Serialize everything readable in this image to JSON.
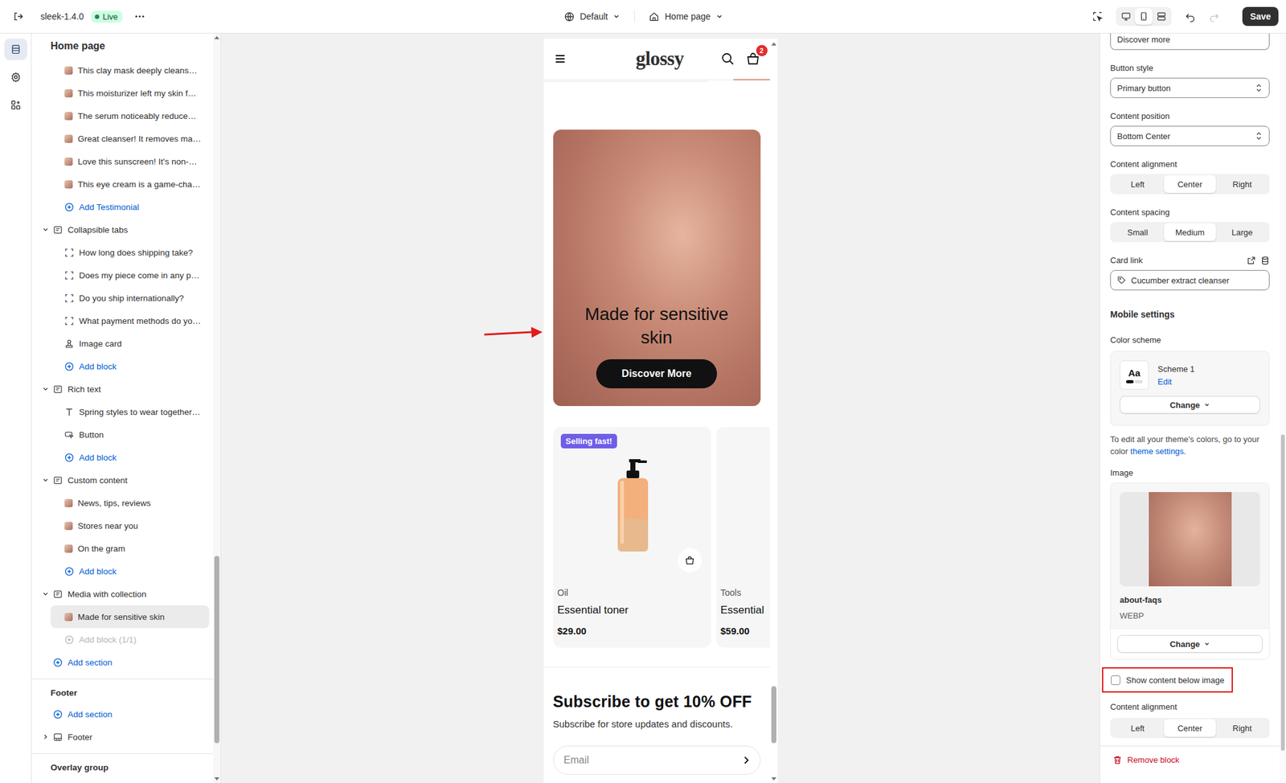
{
  "topbar": {
    "theme": "sleek-1.4.0",
    "status": "Live",
    "context": "Default",
    "page": "Home page",
    "save": "Save",
    "views": [
      {
        "selected": false
      },
      {
        "selected": true
      },
      {
        "selected": false
      }
    ],
    "redo_disabled": true
  },
  "rail": [
    {
      "selected": true
    },
    {
      "selected": false
    },
    {
      "selected": false
    }
  ],
  "sidebar": {
    "title": "Home page",
    "items": [
      {
        "kind": "photo",
        "label": "This clay mask deeply cleans…",
        "selected": false
      },
      {
        "kind": "photo",
        "label": "This moisturizer left my skin f…",
        "selected": false
      },
      {
        "kind": "photo",
        "label": "The serum noticeably reduce…",
        "selected": false
      },
      {
        "kind": "photo",
        "label": "Great cleanser! It removes ma…",
        "selected": false
      },
      {
        "kind": "photo",
        "label": "Love this sunscreen! It's non-…",
        "selected": false
      },
      {
        "kind": "photo",
        "label": "This eye cream is a game-cha…",
        "selected": false
      },
      {
        "kind": "add",
        "label": "Add Testimonial",
        "selected": false,
        "disabled": false
      },
      {
        "kind": "section",
        "label": "Collapsible tabs",
        "selected": false,
        "expanded": true
      },
      {
        "kind": "tab",
        "label": "How long does shipping take?",
        "selected": false
      },
      {
        "kind": "tab",
        "label": "Does my piece come in any p…",
        "selected": false
      },
      {
        "kind": "tab",
        "label": "Do you ship internationally?",
        "selected": false
      },
      {
        "kind": "tab",
        "label": "What payment methods do yo…",
        "selected": false
      },
      {
        "kind": "card",
        "label": "Image card",
        "selected": false
      },
      {
        "kind": "add",
        "label": "Add block",
        "selected": false,
        "disabled": false
      },
      {
        "kind": "section",
        "label": "Rich text",
        "selected": false,
        "expanded": true
      },
      {
        "kind": "text",
        "label": "Spring styles to wear together…",
        "selected": false
      },
      {
        "kind": "button",
        "label": "Button",
        "selected": false
      },
      {
        "kind": "add",
        "label": "Add block",
        "selected": false,
        "disabled": false
      },
      {
        "kind": "section",
        "label": "Custom content",
        "selected": false,
        "expanded": true
      },
      {
        "kind": "photo",
        "label": "News, tips, reviews",
        "selected": false
      },
      {
        "kind": "photo",
        "label": "Stores near you",
        "selected": false
      },
      {
        "kind": "photo",
        "label": "On the gram",
        "selected": false
      },
      {
        "kind": "add",
        "label": "Add block",
        "selected": false,
        "disabled": false
      },
      {
        "kind": "section",
        "label": "Media with collection",
        "selected": false,
        "expanded": true
      },
      {
        "kind": "photo",
        "label": "Made for sensitive skin",
        "selected": true
      },
      {
        "kind": "add",
        "label": "Add block (1/1)",
        "selected": false,
        "disabled": true
      },
      {
        "kind": "addsection",
        "label": "Add section",
        "selected": false,
        "disabled": false
      }
    ],
    "footer": {
      "heading": "Footer",
      "add": "Add section",
      "sections": [
        {
          "label": "Footer",
          "expanded": false
        }
      ]
    },
    "overlay": {
      "heading": "Overlay group"
    }
  },
  "preview": {
    "logo": "glossy",
    "cart_count": "2",
    "hero": {
      "title": "Made for sensitive skin",
      "button": "Discover More"
    },
    "products": [
      {
        "badge": "Selling fast!",
        "category": "Oil",
        "name": "Essential toner",
        "price": "$29.00"
      },
      {
        "badge": "",
        "category": "Tools",
        "name": "Essential",
        "price": "$59.00"
      }
    ],
    "subscribe": {
      "title": "Subscribe to get 10% OFF",
      "text": "Subscribe for store updates and discounts.",
      "placeholder": "Email"
    }
  },
  "settings": {
    "top_field": "Discover more",
    "button_style": {
      "label": "Button style",
      "value": "Primary button"
    },
    "content_position": {
      "label": "Content position",
      "value": "Bottom Center"
    },
    "content_alignment": {
      "label": "Content alignment",
      "options": [
        {
          "label": "Left",
          "selected": false
        },
        {
          "label": "Center",
          "selected": true
        },
        {
          "label": "Right",
          "selected": false
        }
      ]
    },
    "content_spacing": {
      "label": "Content spacing",
      "options": [
        {
          "label": "Small",
          "selected": false
        },
        {
          "label": "Medium",
          "selected": true
        },
        {
          "label": "Large",
          "selected": false
        }
      ]
    },
    "card_link": {
      "label": "Card link",
      "value": "Cucumber extract cleanser"
    },
    "mobile": {
      "heading": "Mobile settings",
      "color_scheme": {
        "label": "Color scheme",
        "sample": "Aa",
        "name": "Scheme 1",
        "edit": "Edit",
        "change": "Change"
      },
      "help": {
        "text": "To edit all your theme's colors, go to your color ",
        "link": "theme settings",
        "end": "."
      },
      "image": {
        "label": "Image",
        "filename": "about-faqs",
        "format": "WEBP",
        "change": "Change"
      },
      "below": {
        "label": "Show content below image",
        "checked": false
      },
      "alignment": {
        "label": "Content alignment",
        "options": [
          {
            "label": "Left",
            "selected": false
          },
          {
            "label": "Center",
            "selected": true
          },
          {
            "label": "Right",
            "selected": false
          }
        ]
      }
    },
    "remove": "Remove block"
  }
}
